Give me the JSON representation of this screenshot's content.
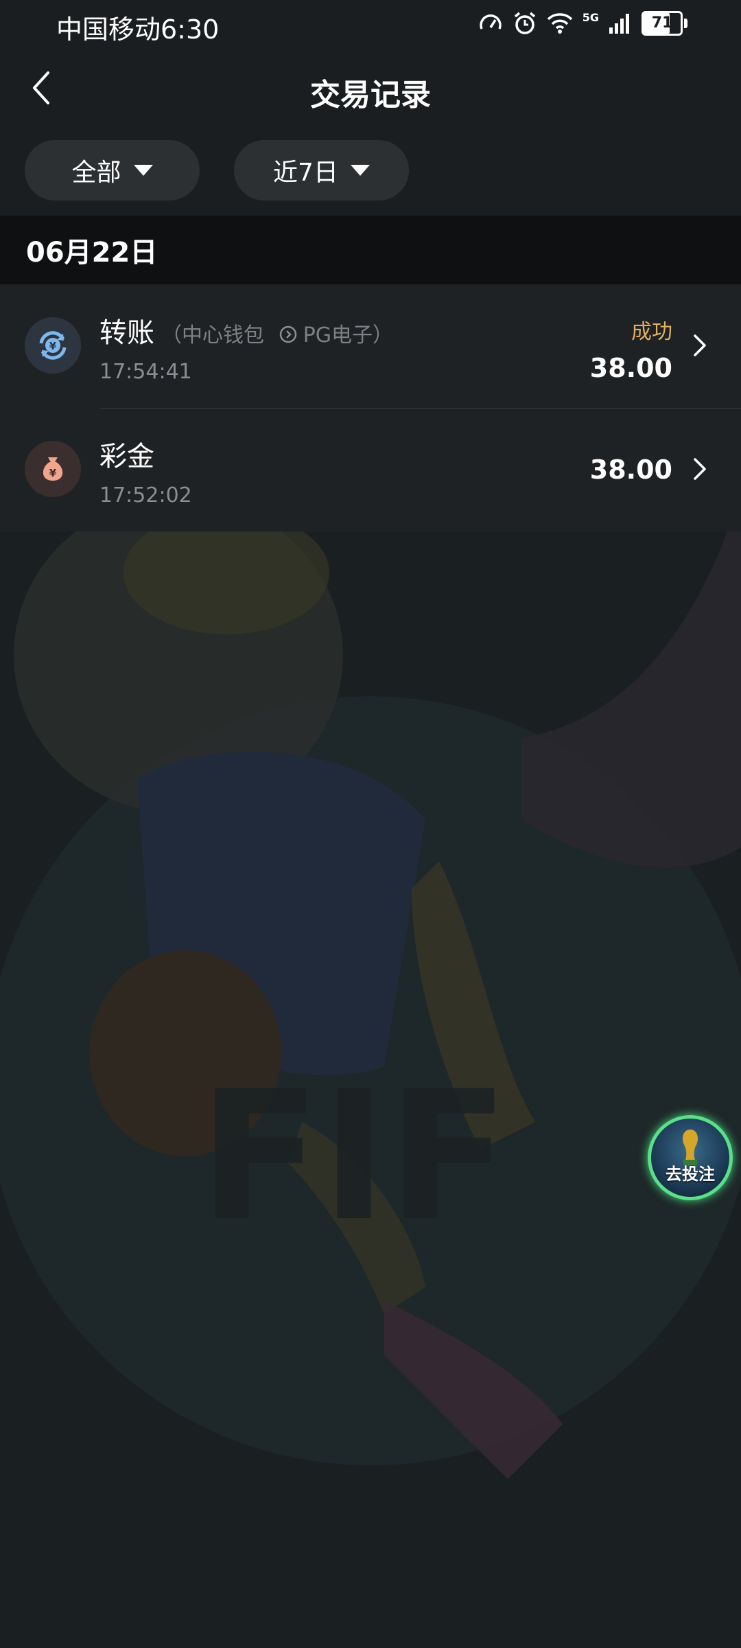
{
  "status_bar": {
    "carrier_time": "中国移动6:30",
    "network": "5G",
    "battery": "71",
    "battery_level": 0.71
  },
  "header": {
    "title": "交易记录"
  },
  "filters": {
    "type_label": "全部",
    "range_label": "近7日"
  },
  "date_group": "06月22日",
  "transactions": [
    {
      "title": "转账",
      "detail_open": "（中心钱包",
      "detail_close": "PG电子）",
      "time": "17:54:41",
      "status": "成功",
      "amount": "38.00",
      "icon": "transfer-icon"
    },
    {
      "title": "彩金",
      "time": "17:52:02",
      "amount": "38.00",
      "icon": "money-bag-icon"
    }
  ],
  "float_button": {
    "label": "去投注"
  },
  "colors": {
    "background": "#1b1e20",
    "status_success": "#e0b060",
    "accent_glow": "#5be08a"
  }
}
